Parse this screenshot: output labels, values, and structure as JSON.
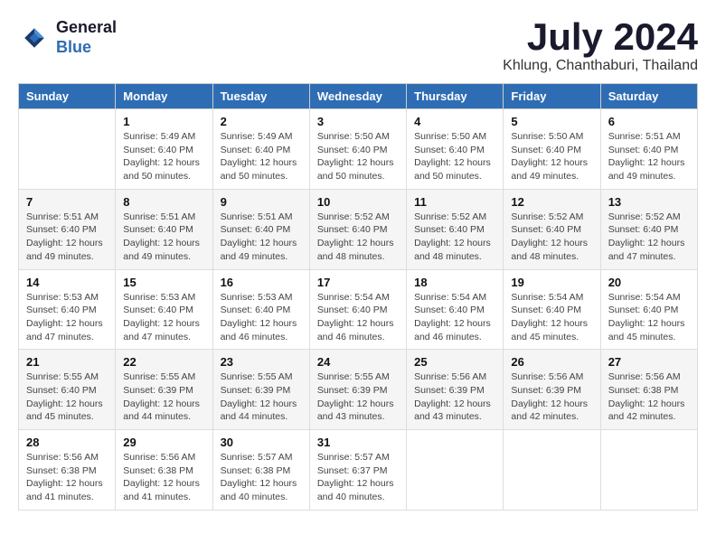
{
  "logo": {
    "general": "General",
    "blue": "Blue"
  },
  "title": {
    "month_year": "July 2024",
    "location": "Khlung, Chanthaburi, Thailand"
  },
  "weekdays": [
    "Sunday",
    "Monday",
    "Tuesday",
    "Wednesday",
    "Thursday",
    "Friday",
    "Saturday"
  ],
  "weeks": [
    [
      {
        "day": "",
        "detail": ""
      },
      {
        "day": "1",
        "detail": "Sunrise: 5:49 AM\nSunset: 6:40 PM\nDaylight: 12 hours\nand 50 minutes."
      },
      {
        "day": "2",
        "detail": "Sunrise: 5:49 AM\nSunset: 6:40 PM\nDaylight: 12 hours\nand 50 minutes."
      },
      {
        "day": "3",
        "detail": "Sunrise: 5:50 AM\nSunset: 6:40 PM\nDaylight: 12 hours\nand 50 minutes."
      },
      {
        "day": "4",
        "detail": "Sunrise: 5:50 AM\nSunset: 6:40 PM\nDaylight: 12 hours\nand 50 minutes."
      },
      {
        "day": "5",
        "detail": "Sunrise: 5:50 AM\nSunset: 6:40 PM\nDaylight: 12 hours\nand 49 minutes."
      },
      {
        "day": "6",
        "detail": "Sunrise: 5:51 AM\nSunset: 6:40 PM\nDaylight: 12 hours\nand 49 minutes."
      }
    ],
    [
      {
        "day": "7",
        "detail": "Sunrise: 5:51 AM\nSunset: 6:40 PM\nDaylight: 12 hours\nand 49 minutes."
      },
      {
        "day": "8",
        "detail": "Sunrise: 5:51 AM\nSunset: 6:40 PM\nDaylight: 12 hours\nand 49 minutes."
      },
      {
        "day": "9",
        "detail": "Sunrise: 5:51 AM\nSunset: 6:40 PM\nDaylight: 12 hours\nand 49 minutes."
      },
      {
        "day": "10",
        "detail": "Sunrise: 5:52 AM\nSunset: 6:40 PM\nDaylight: 12 hours\nand 48 minutes."
      },
      {
        "day": "11",
        "detail": "Sunrise: 5:52 AM\nSunset: 6:40 PM\nDaylight: 12 hours\nand 48 minutes."
      },
      {
        "day": "12",
        "detail": "Sunrise: 5:52 AM\nSunset: 6:40 PM\nDaylight: 12 hours\nand 48 minutes."
      },
      {
        "day": "13",
        "detail": "Sunrise: 5:52 AM\nSunset: 6:40 PM\nDaylight: 12 hours\nand 47 minutes."
      }
    ],
    [
      {
        "day": "14",
        "detail": "Sunrise: 5:53 AM\nSunset: 6:40 PM\nDaylight: 12 hours\nand 47 minutes."
      },
      {
        "day": "15",
        "detail": "Sunrise: 5:53 AM\nSunset: 6:40 PM\nDaylight: 12 hours\nand 47 minutes."
      },
      {
        "day": "16",
        "detail": "Sunrise: 5:53 AM\nSunset: 6:40 PM\nDaylight: 12 hours\nand 46 minutes."
      },
      {
        "day": "17",
        "detail": "Sunrise: 5:54 AM\nSunset: 6:40 PM\nDaylight: 12 hours\nand 46 minutes."
      },
      {
        "day": "18",
        "detail": "Sunrise: 5:54 AM\nSunset: 6:40 PM\nDaylight: 12 hours\nand 46 minutes."
      },
      {
        "day": "19",
        "detail": "Sunrise: 5:54 AM\nSunset: 6:40 PM\nDaylight: 12 hours\nand 45 minutes."
      },
      {
        "day": "20",
        "detail": "Sunrise: 5:54 AM\nSunset: 6:40 PM\nDaylight: 12 hours\nand 45 minutes."
      }
    ],
    [
      {
        "day": "21",
        "detail": "Sunrise: 5:55 AM\nSunset: 6:40 PM\nDaylight: 12 hours\nand 45 minutes."
      },
      {
        "day": "22",
        "detail": "Sunrise: 5:55 AM\nSunset: 6:39 PM\nDaylight: 12 hours\nand 44 minutes."
      },
      {
        "day": "23",
        "detail": "Sunrise: 5:55 AM\nSunset: 6:39 PM\nDaylight: 12 hours\nand 44 minutes."
      },
      {
        "day": "24",
        "detail": "Sunrise: 5:55 AM\nSunset: 6:39 PM\nDaylight: 12 hours\nand 43 minutes."
      },
      {
        "day": "25",
        "detail": "Sunrise: 5:56 AM\nSunset: 6:39 PM\nDaylight: 12 hours\nand 43 minutes."
      },
      {
        "day": "26",
        "detail": "Sunrise: 5:56 AM\nSunset: 6:39 PM\nDaylight: 12 hours\nand 42 minutes."
      },
      {
        "day": "27",
        "detail": "Sunrise: 5:56 AM\nSunset: 6:38 PM\nDaylight: 12 hours\nand 42 minutes."
      }
    ],
    [
      {
        "day": "28",
        "detail": "Sunrise: 5:56 AM\nSunset: 6:38 PM\nDaylight: 12 hours\nand 41 minutes."
      },
      {
        "day": "29",
        "detail": "Sunrise: 5:56 AM\nSunset: 6:38 PM\nDaylight: 12 hours\nand 41 minutes."
      },
      {
        "day": "30",
        "detail": "Sunrise: 5:57 AM\nSunset: 6:38 PM\nDaylight: 12 hours\nand 40 minutes."
      },
      {
        "day": "31",
        "detail": "Sunrise: 5:57 AM\nSunset: 6:37 PM\nDaylight: 12 hours\nand 40 minutes."
      },
      {
        "day": "",
        "detail": ""
      },
      {
        "day": "",
        "detail": ""
      },
      {
        "day": "",
        "detail": ""
      }
    ]
  ]
}
